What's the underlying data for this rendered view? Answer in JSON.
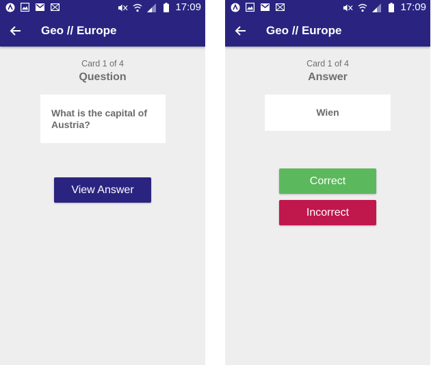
{
  "colors": {
    "primary": "#2a2480",
    "background": "#eeeeee",
    "correct": "#5cb85c",
    "incorrect": "#c0174c"
  },
  "status_bar": {
    "time": "17:09",
    "left_icons": [
      "app-icon",
      "image-icon",
      "gmail-icon",
      "mail-icon"
    ],
    "right_icons": [
      "mute-icon",
      "wifi-icon",
      "signal-icon",
      "battery-icon"
    ]
  },
  "screens": [
    {
      "title": "Geo // Europe",
      "counter": "Card 1 of 4",
      "side_label": "Question",
      "card_text": "What is the capital of Austria?",
      "button_label": "View Answer"
    },
    {
      "title": "Geo // Europe",
      "counter": "Card 1 of 4",
      "side_label": "Answer",
      "card_text": "Wien",
      "correct_label": "Correct",
      "incorrect_label": "Incorrect"
    }
  ]
}
